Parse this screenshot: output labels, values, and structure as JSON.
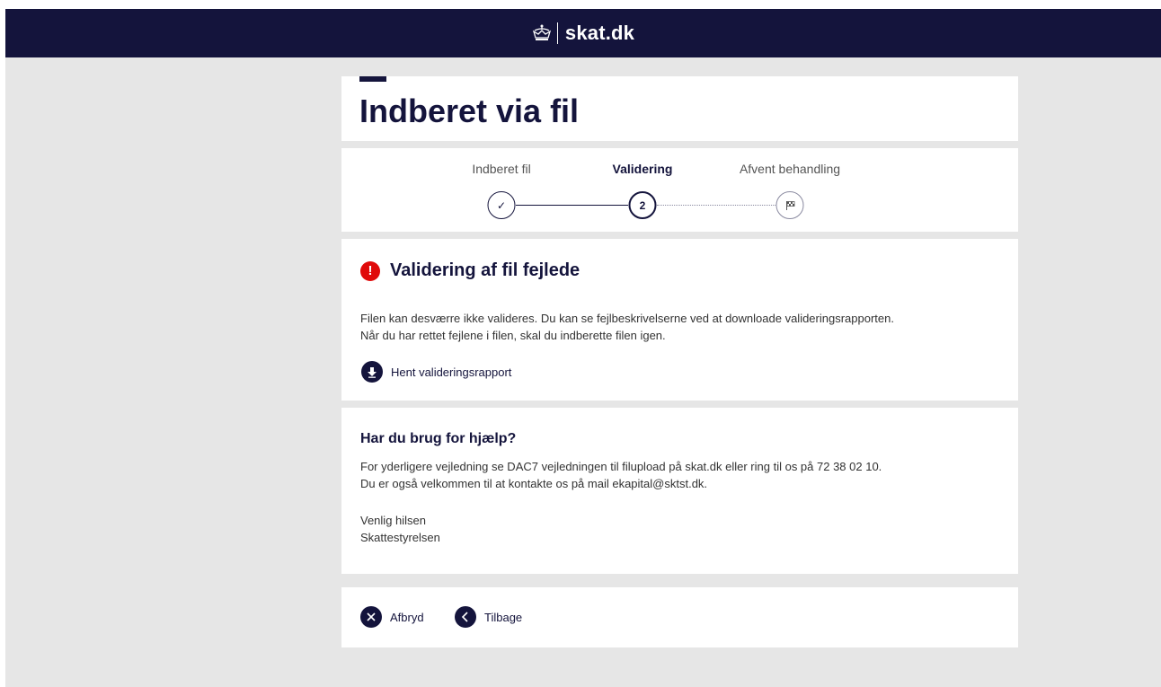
{
  "header": {
    "logo_text": "skat.dk",
    "logo_icon": "crown-icon"
  },
  "page": {
    "title": "Indberet via fil"
  },
  "stepper": {
    "steps": [
      {
        "label": "Indberet fil",
        "marker": "✓",
        "state": "done"
      },
      {
        "label": "Validering",
        "marker": "2",
        "state": "active"
      },
      {
        "label": "Afvent behandling",
        "marker": "flag",
        "state": "pending"
      }
    ]
  },
  "error": {
    "icon": "alert-icon",
    "icon_glyph": "!",
    "title": "Validering af fil fejlede",
    "line1": "Filen kan desværre ikke valideres. Du kan se fejlbeskrivelserne ved at downloade valideringsrapporten.",
    "line2": "Når du har rettet fejlene i filen, skal du indberette filen igen.",
    "download_label": "Hent valideringsrapport"
  },
  "help": {
    "title": "Har du brug for hjælp?",
    "line1": "For yderligere vejledning se DAC7 vejledningen til filupload på skat.dk eller ring til os på 72 38 02 10.",
    "line2": "Du er også velkommen til at kontakte os på mail ekapital@sktst.dk.",
    "greeting": "Venlig hilsen",
    "signature": "Skattestyrelsen"
  },
  "actions": {
    "cancel_label": "Afbryd",
    "back_label": "Tilbage"
  },
  "colors": {
    "navy": "#14143c",
    "error_red": "#e00a0a",
    "background": "#e6e6e6"
  }
}
